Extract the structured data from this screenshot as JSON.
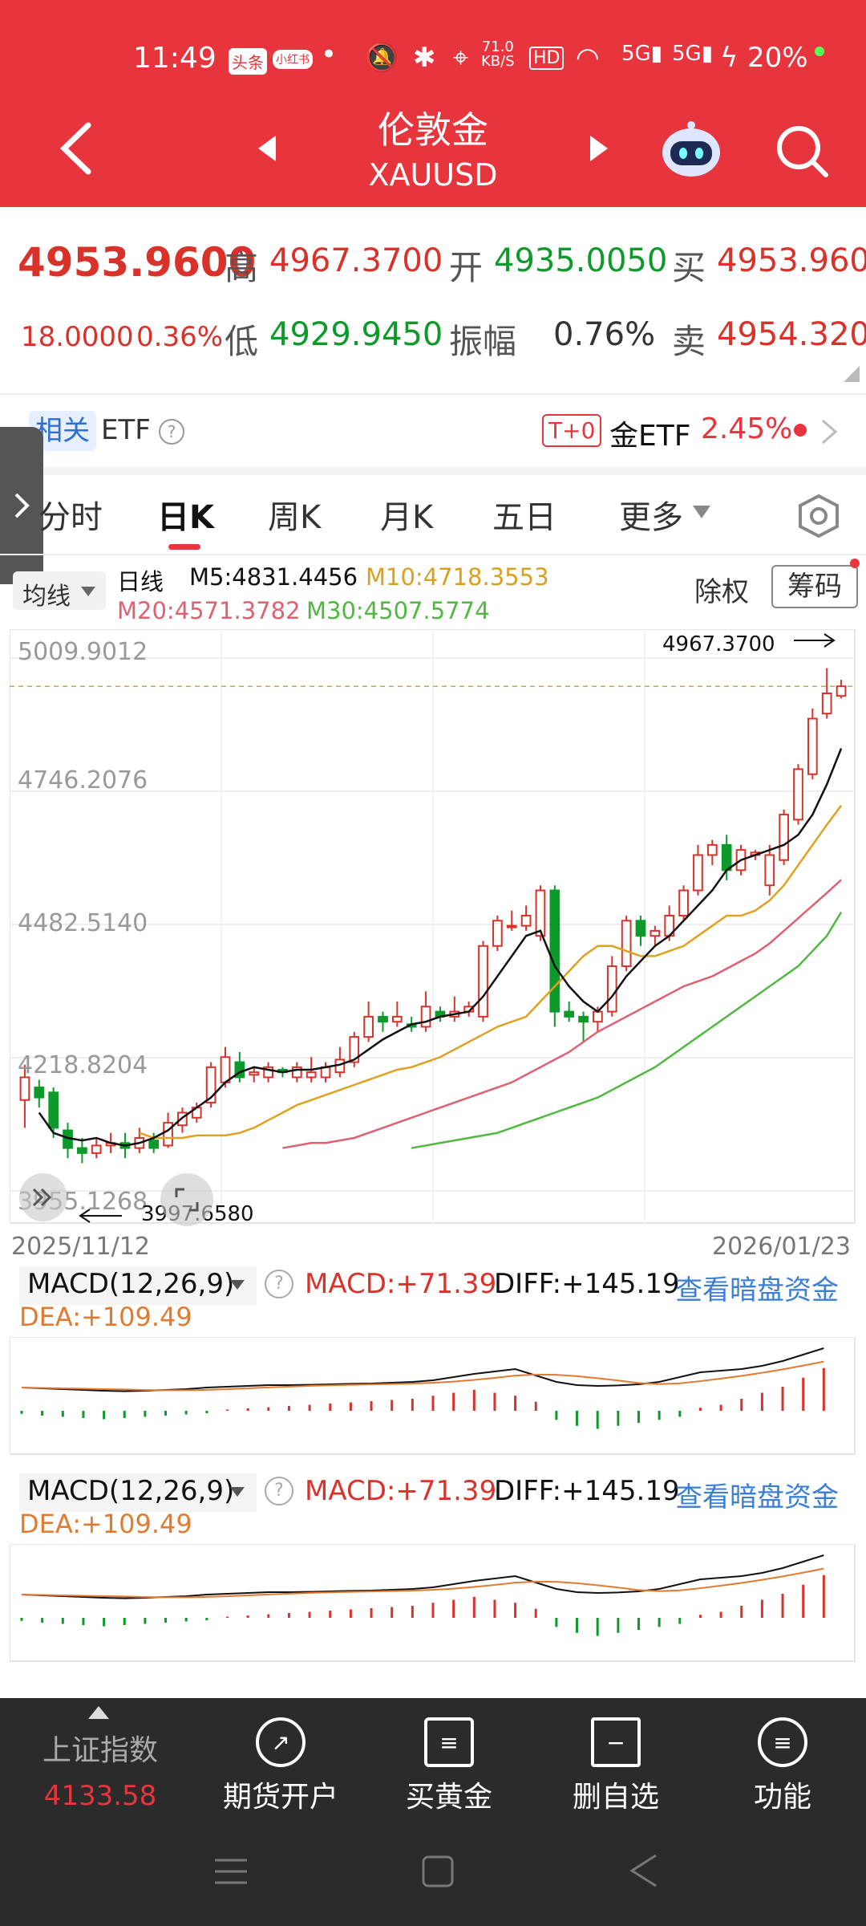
{
  "status": {
    "time": "11:49",
    "net_speed": "71.0\nKB/S",
    "battery": "20%",
    "badges": [
      "头条",
      "小红书"
    ]
  },
  "header": {
    "title": "伦敦金",
    "subtitle": "XAUUSD"
  },
  "quote": {
    "price": "4953.9600",
    "change": "18.0000",
    "change_pct": "0.36%",
    "high_label": "高",
    "high": "4967.3700",
    "open_label": "开",
    "open": "4935.0050",
    "buy_label": "买",
    "buy": "4953.9600",
    "low_label": "低",
    "low": "4929.9450",
    "amp_label": "振幅",
    "amp": "0.76%",
    "sell_label": "卖",
    "sell": "4954.3200"
  },
  "etf": {
    "tag": "相关",
    "label": "ETF",
    "t0": "T+0",
    "name": "金ETF",
    "pct": "2.45%"
  },
  "tabs": [
    "分时",
    "日K",
    "周K",
    "月K",
    "五日",
    "更多"
  ],
  "ma": {
    "selector": "均线",
    "type": "日线",
    "m5": "M5:4831.4456",
    "m10": "M10:4718.3553",
    "m20": "M20:4571.3782",
    "m30": "M30:4507.5774",
    "fuquan": "除权",
    "chouma": "筹码"
  },
  "chart_labels": {
    "y_ticks": [
      "5009.9012",
      "4746.2076",
      "4482.5140",
      "4218.8204",
      "3955.1268"
    ],
    "high_mark": "4967.3700",
    "low_mark": "3997.6580",
    "date_start": "2025/11/12",
    "date_end": "2026/01/23"
  },
  "macd": {
    "title": "MACD(12,26,9)",
    "macd": "MACD:+71.39",
    "diff": "DIFF:+145.19",
    "dea": "DEA:+109.49",
    "link": "查看暗盘资金"
  },
  "bottom": {
    "index_name": "上证指数",
    "index_value": "4133.58",
    "items": [
      "期货开户",
      "买黄金",
      "删自选",
      "功能"
    ]
  },
  "colors": {
    "red": "#e8343c",
    "up": "#d8322b",
    "down": "#0d9a2a",
    "m5": "#111111",
    "m10": "#e0a020",
    "m20": "#e06070",
    "m30": "#50b840"
  },
  "chart_data": {
    "type": "candlestick",
    "ylim": [
      3955.1268,
      5009.9012
    ],
    "candles": [
      [
        4135,
        4180,
        4080,
        4205
      ],
      [
        4160,
        4140,
        4120,
        4175
      ],
      [
        4150,
        4080,
        4060,
        4160
      ],
      [
        4075,
        4040,
        4020,
        4090
      ],
      [
        4040,
        4030,
        4010,
        4060
      ],
      [
        4030,
        4045,
        4020,
        4060
      ],
      [
        4045,
        4050,
        4030,
        4070
      ],
      [
        4050,
        4040,
        4020,
        4070
      ],
      [
        4040,
        4060,
        4030,
        4080
      ],
      [
        4055,
        4040,
        4030,
        4070
      ],
      [
        4045,
        4090,
        4040,
        4110
      ],
      [
        4085,
        4110,
        4070,
        4120
      ],
      [
        4100,
        4120,
        4090,
        4130
      ],
      [
        4130,
        4200,
        4120,
        4210
      ],
      [
        4170,
        4220,
        4160,
        4240
      ],
      [
        4210,
        4180,
        4170,
        4230
      ],
      [
        4185,
        4190,
        4170,
        4200
      ],
      [
        4180,
        4200,
        4170,
        4210
      ],
      [
        4195,
        4190,
        4180,
        4200
      ],
      [
        4180,
        4200,
        4170,
        4210
      ],
      [
        4180,
        4190,
        4170,
        4220
      ],
      [
        4180,
        4200,
        4170,
        4210
      ],
      [
        4190,
        4215,
        4180,
        4240
      ],
      [
        4210,
        4260,
        4200,
        4270
      ],
      [
        4260,
        4300,
        4250,
        4330
      ],
      [
        4300,
        4290,
        4270,
        4310
      ],
      [
        4290,
        4300,
        4280,
        4330
      ],
      [
        4285,
        4280,
        4270,
        4300
      ],
      [
        4280,
        4320,
        4270,
        4350
      ],
      [
        4310,
        4300,
        4290,
        4320
      ],
      [
        4300,
        4310,
        4290,
        4340
      ],
      [
        4310,
        4320,
        4300,
        4330
      ],
      [
        4300,
        4440,
        4290,
        4450
      ],
      [
        4440,
        4490,
        4430,
        4500
      ],
      [
        4480,
        4480,
        4470,
        4510
      ],
      [
        4480,
        4500,
        4470,
        4520
      ],
      [
        4460,
        4550,
        4450,
        4560
      ],
      [
        4550,
        4310,
        4280,
        4560
      ],
      [
        4310,
        4300,
        4290,
        4330
      ],
      [
        4300,
        4290,
        4250,
        4310
      ],
      [
        4290,
        4310,
        4270,
        4320
      ],
      [
        4310,
        4400,
        4300,
        4420
      ],
      [
        4400,
        4490,
        4390,
        4500
      ],
      [
        4490,
        4460,
        4440,
        4500
      ],
      [
        4460,
        4470,
        4440,
        4480
      ],
      [
        4460,
        4500,
        4450,
        4520
      ],
      [
        4500,
        4550,
        4490,
        4560
      ],
      [
        4550,
        4620,
        4540,
        4640
      ],
      [
        4620,
        4640,
        4600,
        4650
      ],
      [
        4640,
        4590,
        4570,
        4660
      ],
      [
        4590,
        4630,
        4580,
        4640
      ],
      [
        4620,
        4625,
        4610,
        4630
      ],
      [
        4560,
        4620,
        4540,
        4640
      ],
      [
        4610,
        4700,
        4600,
        4710
      ],
      [
        4690,
        4790,
        4680,
        4800
      ],
      [
        4780,
        4890,
        4770,
        4910
      ],
      [
        4900,
        4940,
        4890,
        4990
      ],
      [
        4935,
        4954,
        4930,
        4967
      ]
    ],
    "m5": [
      4110,
      4070,
      4060,
      4055,
      4060,
      4050,
      4045,
      4050,
      4060,
      4075,
      4100,
      4120,
      4140,
      4170,
      4190,
      4200,
      4195,
      4190,
      4195,
      4195,
      4200,
      4205,
      4215,
      4235,
      4255,
      4270,
      4285,
      4290,
      4300,
      4305,
      4310,
      4340,
      4380,
      4420,
      4460,
      4470,
      4400,
      4360,
      4330,
      4310,
      4340,
      4380,
      4410,
      4440,
      4460,
      4490,
      4520,
      4550,
      4590,
      4610,
      4620,
      4630,
      4640,
      4660,
      4700,
      4760,
      4831
    ],
    "m10": [
      4070,
      4060,
      4060,
      4060,
      4065,
      4065,
      4065,
      4070,
      4080,
      4095,
      4110,
      4125,
      4135,
      4145,
      4155,
      4165,
      4175,
      4185,
      4195,
      4200,
      4210,
      4220,
      4235,
      4250,
      4265,
      4280,
      4290,
      4300,
      4330,
      4360,
      4390,
      4420,
      4440,
      4440,
      4430,
      4420,
      4420,
      4430,
      4440,
      4460,
      4480,
      4500,
      4500,
      4510,
      4530,
      4560,
      4600,
      4640,
      4680,
      4718
    ],
    "m20": [
      4040,
      4045,
      4050,
      4050,
      4055,
      4060,
      4070,
      4080,
      4090,
      4100,
      4110,
      4120,
      4130,
      4140,
      4150,
      4160,
      4170,
      4185,
      4200,
      4215,
      4230,
      4250,
      4270,
      4285,
      4300,
      4315,
      4330,
      4345,
      4360,
      4370,
      4380,
      4395,
      4410,
      4425,
      4445,
      4470,
      4495,
      4520,
      4545,
      4571
    ],
    "m30": [
      4040,
      4045,
      4050,
      4055,
      4060,
      4065,
      4070,
      4080,
      4090,
      4100,
      4110,
      4120,
      4130,
      4140,
      4155,
      4170,
      4185,
      4200,
      4220,
      4240,
      4260,
      4280,
      4300,
      4320,
      4340,
      4360,
      4380,
      4400,
      4430,
      4460,
      4507
    ],
    "macd_diff": [
      -5,
      -10,
      -15,
      -20,
      -25,
      -28,
      -25,
      -20,
      -15,
      -5,
      0,
      5,
      10,
      10,
      12,
      15,
      18,
      20,
      25,
      30,
      40,
      60,
      80,
      95,
      110,
      70,
      30,
      10,
      5,
      8,
      15,
      30,
      60,
      90,
      100,
      110,
      130,
      160,
      200,
      240
    ],
    "macd_hist": [
      -5,
      -8,
      -10,
      -12,
      -14,
      -12,
      -10,
      -8,
      -6,
      -4,
      2,
      4,
      6,
      8,
      10,
      12,
      14,
      16,
      18,
      20,
      25,
      30,
      35,
      30,
      25,
      15,
      -15,
      -25,
      -30,
      -25,
      -20,
      -15,
      -10,
      5,
      10,
      20,
      30,
      40,
      55,
      71
    ]
  }
}
